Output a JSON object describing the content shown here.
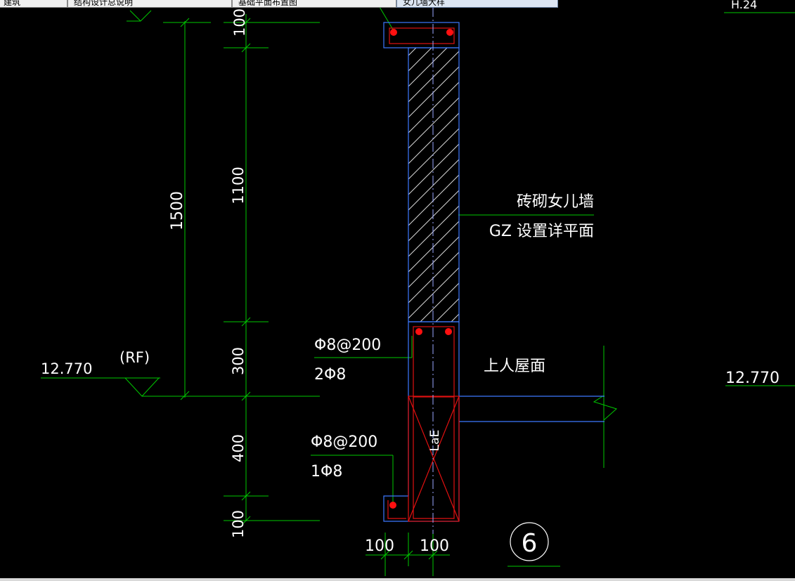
{
  "tabs": [
    {
      "label": "建筑"
    },
    {
      "label": "结构设计总说明"
    },
    {
      "label": "基础平面布置图"
    },
    {
      "label": "女儿墙大样"
    }
  ],
  "dims": {
    "d100_top": "100",
    "d1100": "1100",
    "d1500": "1500",
    "d300": "300",
    "d400": "400",
    "d100_bot": "100",
    "w100_left": "100",
    "w100_right": "100"
  },
  "elev": {
    "left_value": "12.770",
    "left_tag": "(RF)",
    "right_value": "12.770",
    "top_right_partial": "H.24"
  },
  "labels": {
    "wall_line1": "砖砌女儿墙",
    "wall_line2": "GZ 设置详平面",
    "upper_rebar_stirrup": "Φ8@200",
    "upper_rebar_main": "2Φ8",
    "roof_label": "上人屋面",
    "lower_rebar_stirrup": "Φ8@200",
    "lower_rebar_main": "1Φ8",
    "anchor": "LaE",
    "detail_no": "6"
  },
  "colors": {
    "dim": "#00c800",
    "outline": "#3c78ff",
    "rebar": "#e01010",
    "text": "#ffffff",
    "background": "#000000"
  }
}
